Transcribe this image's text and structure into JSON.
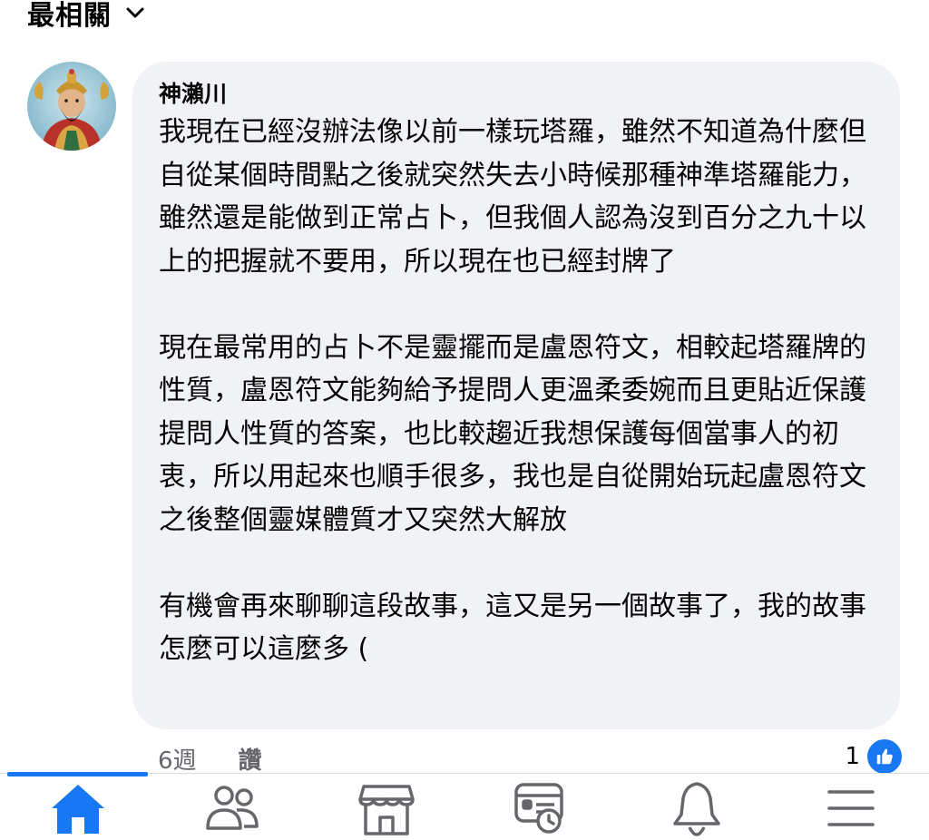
{
  "sort": {
    "label": "最相關",
    "icon": "chevron-down-icon"
  },
  "comment": {
    "author": "神瀨川",
    "paragraphs": [
      "我現在已經沒辦法像以前一樣玩塔羅，雖然不知道為什麼但自從某個時間點之後就突然失去小時候那種神準塔羅能力，雖然還是能做到正常占卜，但我個人認為沒到百分之九十以上的把握就不要用，所以現在也已經封牌了",
      "現在最常用的占卜不是靈擺而是盧恩符文，相較起塔羅牌的性質，盧恩符文能夠給予提問人更溫柔委婉而且更貼近保護提問人性質的答案，也比較趨近我想保護每個當事人的初衷，所以用起來也順手很多，我也是自從開始玩起盧恩符文之後整個靈媒體質才又突然大解放",
      "有機會再來聊聊這段故事，這又是另一個故事了，我的故事怎麼可以這麼多 ("
    ],
    "time": "6週",
    "like_label": "讚",
    "reaction_count": "1",
    "reaction_icon": "like-icon"
  },
  "tabbar": {
    "tabs": [
      {
        "icon": "home-icon",
        "active": true
      },
      {
        "icon": "friends-icon",
        "active": false
      },
      {
        "icon": "marketplace-icon",
        "active": false
      },
      {
        "icon": "feeds-icon",
        "active": false
      },
      {
        "icon": "bell-icon",
        "active": false
      },
      {
        "icon": "menu-icon",
        "active": false
      }
    ]
  },
  "colors": {
    "accent": "#1877f2",
    "bubble": "#f0f2f5",
    "secondary_text": "#65676b",
    "icon_inactive": "#65676b"
  }
}
